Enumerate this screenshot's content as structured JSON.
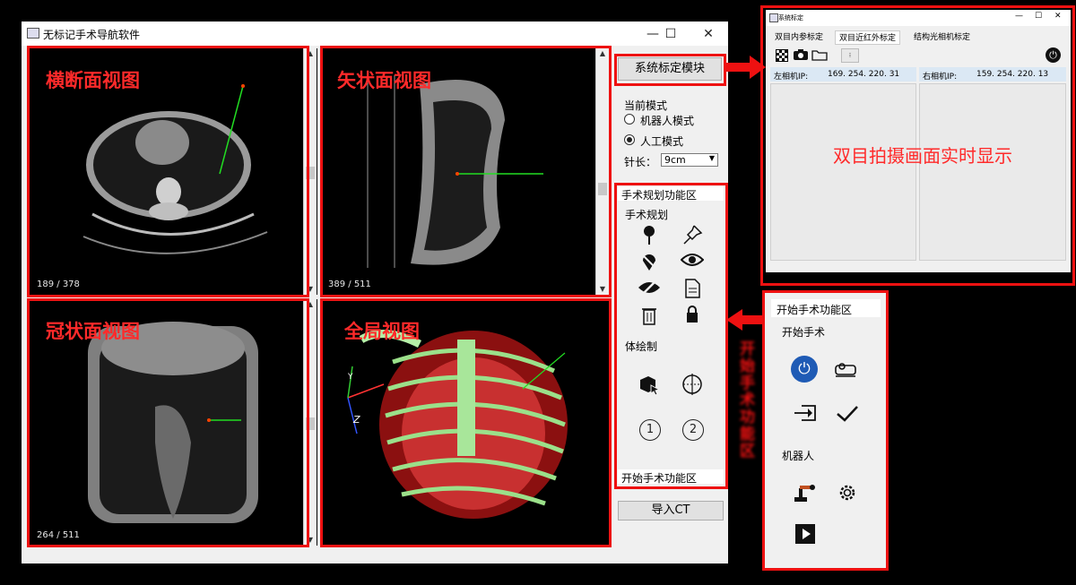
{
  "main_window": {
    "title": "无标记手术导航软件",
    "controls": {
      "minimize": "—",
      "maximize": "☐",
      "close": "✕"
    }
  },
  "views": {
    "axial": {
      "label": "横断面视图",
      "slice": "189 / 378"
    },
    "sagittal": {
      "label": "矢状面视图",
      "slice": "389 / 511"
    },
    "coronal": {
      "label": "冠状面视图",
      "slice": "264 / 511"
    },
    "global": {
      "label": "全局视图",
      "axes": {
        "y": "Y",
        "z": "Z"
      }
    }
  },
  "side_panel": {
    "calib_button": "系统标定模块",
    "mode_title": "当前模式",
    "mode_options": [
      "机器人模式",
      "人工模式"
    ],
    "mode_selected": "人工模式",
    "needle_label": "针长：",
    "needle_value": "9cm",
    "planning_section": "手术规划功能区",
    "planning_group": "手术规划",
    "planning_tools": [
      "map-pin-icon",
      "pushpin-icon",
      "pin-off-icon",
      "eye-icon",
      "eye-off-icon",
      "document-icon",
      "trash-icon",
      "lock-icon"
    ],
    "render_group": "体绘制",
    "render_tools": [
      "cube-cursor-icon",
      "sphere-cut-icon"
    ],
    "render_numbers": [
      "1",
      "2"
    ],
    "start_section": "开始手术功能区",
    "import_button": "导入CT"
  },
  "calib_window": {
    "title": "系统标定",
    "tabs": [
      "双目内参标定",
      "双目近红外标定",
      "结构光相机标定"
    ],
    "active_tab": "双目近红外标定",
    "left_ip_label": "左相机IP:",
    "left_ip": "169. 254. 220. 31",
    "right_ip_label": "右相机IP:",
    "right_ip": "159. 254. 220. 13",
    "live_label": "双目拍摄画面实时显示"
  },
  "surgery_panel": {
    "section": "开始手术功能区",
    "start_group": "开始手术",
    "robot_group": "机器人"
  },
  "annotation": "开始手术功能区",
  "colors": {
    "accent_red": "#ee1111",
    "power_blue": "#1f5bb5",
    "text_red": "#ff2a2a"
  }
}
